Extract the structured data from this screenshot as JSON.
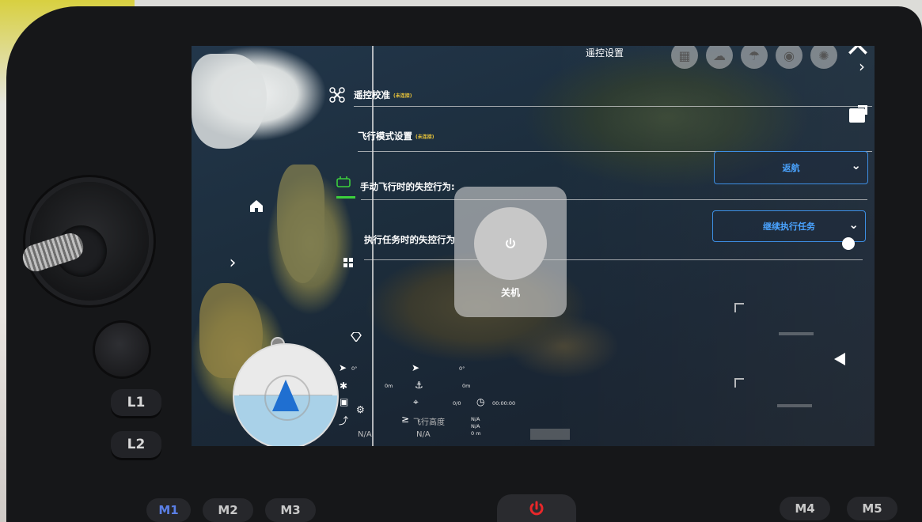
{
  "header": {
    "title": "遥控设置"
  },
  "top_icons": [
    "grid-icon",
    "cloud-icon",
    "parachute-icon",
    "camera-icon",
    "settings-icon"
  ],
  "settings": {
    "rc_calibration": {
      "label": "遥控校准",
      "tag": "(未连接)"
    },
    "flight_mode": {
      "label": "飞行模式设置",
      "tag": "(未连接)"
    },
    "manual_failsafe": {
      "label": "手动飞行时的失控行为:",
      "value": "返航"
    },
    "mission_failsafe": {
      "label": "执行任务时的失控行为",
      "value": "继续执行任务"
    }
  },
  "power_dialog": {
    "label": "关机"
  },
  "telemetry": {
    "heading_value": "0°",
    "home_heading_value": "0°",
    "distance_value": "0m",
    "home_distance_value": "0m",
    "waypoints_value": "0/0",
    "timer_value": "00:00:00",
    "altitude_value": "N/A",
    "flight_height_label": "飞行高度",
    "flight_height_value": "N/A",
    "lat_lon": [
      "N/A",
      "N/A",
      "0 m"
    ]
  },
  "hardware": {
    "left_buttons": [
      "L1",
      "L2"
    ],
    "bottom_buttons": [
      "M1",
      "M2",
      "M3",
      "M4",
      "M5"
    ]
  },
  "colors": {
    "accent_blue": "#3d8fe4",
    "tag_yellow": "#e6c23a",
    "power_red": "#e8272a",
    "active_green": "#3ccf3c"
  }
}
